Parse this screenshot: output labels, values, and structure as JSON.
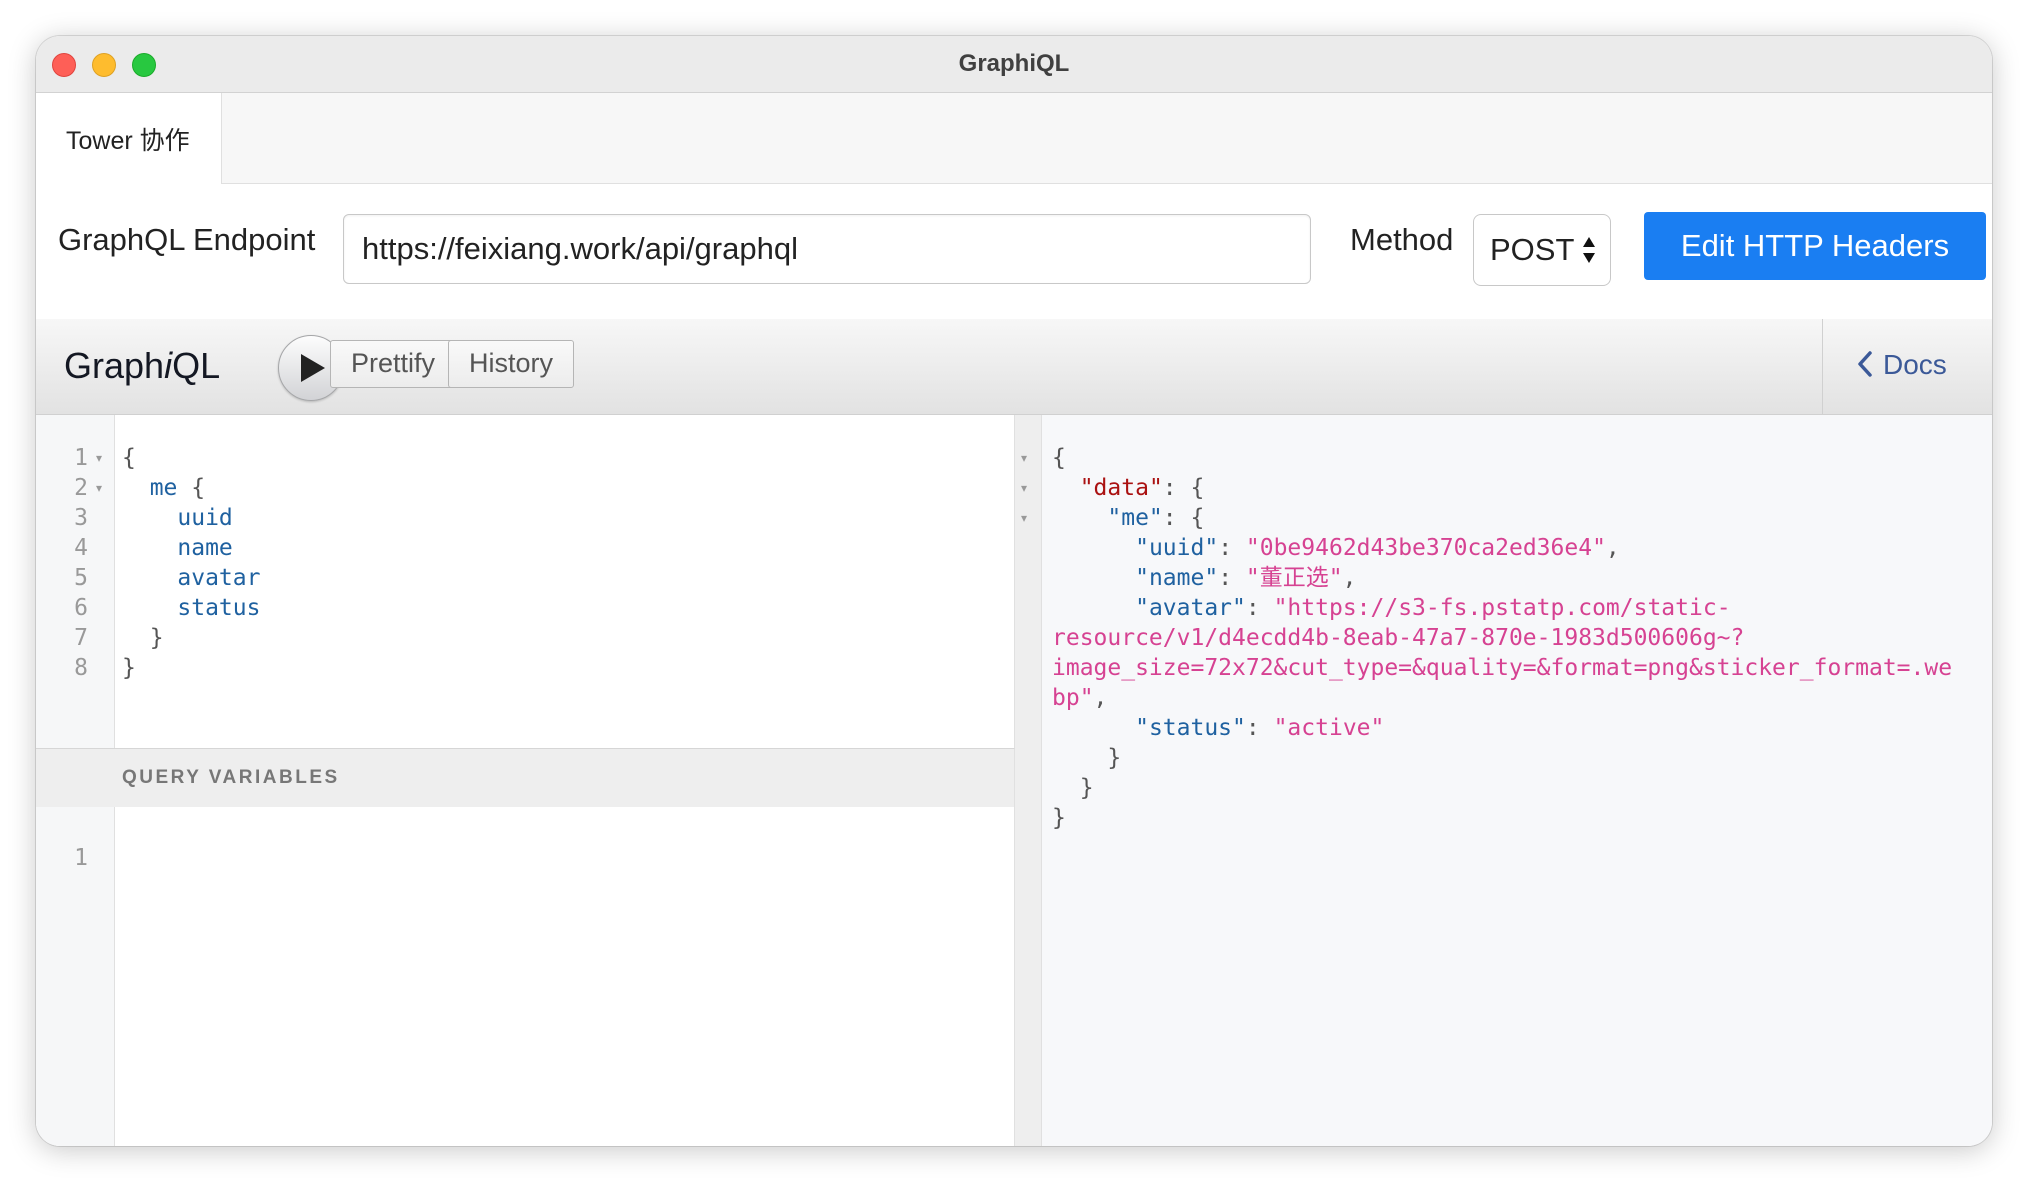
{
  "window": {
    "title": "GraphiQL"
  },
  "tabs": [
    {
      "label": "Tower 协作"
    }
  ],
  "endpoint": {
    "label": "GraphQL Endpoint",
    "url": "https://feixiang.work/api/graphql",
    "method_label": "Method",
    "method_value": "POST",
    "headers_button": "Edit HTTP Headers"
  },
  "toolbar": {
    "title_prefix": "Graph",
    "title_italic": "i",
    "title_suffix": "QL",
    "prettify_label": "Prettify",
    "history_label": "History",
    "docs_label": "Docs",
    "execute_icon": "play-icon",
    "docs_icon": "chevron-left-icon"
  },
  "query_editor": {
    "line_numbers": [
      "1",
      "2",
      "3",
      "4",
      "5",
      "6",
      "7",
      "8"
    ],
    "lines": [
      {
        "parts": [
          {
            "text": "{",
            "kind": "punct"
          }
        ]
      },
      {
        "parts": [
          {
            "text": "  ",
            "kind": "punct"
          },
          {
            "text": "me",
            "kind": "field"
          },
          {
            "text": " {",
            "kind": "punct"
          }
        ]
      },
      {
        "parts": [
          {
            "text": "    ",
            "kind": "punct"
          },
          {
            "text": "uuid",
            "kind": "field"
          }
        ]
      },
      {
        "parts": [
          {
            "text": "    ",
            "kind": "punct"
          },
          {
            "text": "name",
            "kind": "field"
          }
        ]
      },
      {
        "parts": [
          {
            "text": "    ",
            "kind": "punct"
          },
          {
            "text": "avatar",
            "kind": "field"
          }
        ]
      },
      {
        "parts": [
          {
            "text": "    ",
            "kind": "punct"
          },
          {
            "text": "status",
            "kind": "field"
          }
        ]
      },
      {
        "parts": [
          {
            "text": "  }",
            "kind": "punct"
          }
        ]
      },
      {
        "parts": [
          {
            "text": "}",
            "kind": "punct"
          }
        ]
      }
    ]
  },
  "variables": {
    "title": "QUERY VARIABLES",
    "line_numbers": [
      "1"
    ]
  },
  "result": {
    "lines": [
      {
        "parts": [
          {
            "text": "{",
            "kind": "punct"
          }
        ]
      },
      {
        "parts": [
          {
            "text": "  ",
            "kind": "punct"
          },
          {
            "text": "\"data\"",
            "kind": "key"
          },
          {
            "text": ": {",
            "kind": "punct"
          }
        ]
      },
      {
        "parts": [
          {
            "text": "    ",
            "kind": "punct"
          },
          {
            "text": "\"me\"",
            "kind": "key2"
          },
          {
            "text": ": {",
            "kind": "punct"
          }
        ]
      },
      {
        "parts": [
          {
            "text": "      ",
            "kind": "punct"
          },
          {
            "text": "\"uuid\"",
            "kind": "key2"
          },
          {
            "text": ": ",
            "kind": "punct"
          },
          {
            "text": "\"0be9462d43be370ca2ed36e4\"",
            "kind": "string"
          },
          {
            "text": ",",
            "kind": "punct"
          }
        ]
      },
      {
        "parts": [
          {
            "text": "      ",
            "kind": "punct"
          },
          {
            "text": "\"name\"",
            "kind": "key2"
          },
          {
            "text": ": ",
            "kind": "punct"
          },
          {
            "text": "\"董正选\"",
            "kind": "string"
          },
          {
            "text": ",",
            "kind": "punct"
          }
        ]
      },
      {
        "parts": [
          {
            "text": "      ",
            "kind": "punct"
          },
          {
            "text": "\"avatar\"",
            "kind": "key2"
          },
          {
            "text": ": ",
            "kind": "punct"
          },
          {
            "text": "\"https://s3-fs.pstatp.com/static-",
            "kind": "string"
          }
        ]
      },
      {
        "parts": [
          {
            "text": "resource/v1/d4ecdd4b-8eab-47a7-870e-1983d500606g~?",
            "kind": "string"
          }
        ]
      },
      {
        "parts": [
          {
            "text": "image_size=72x72&cut_type=&quality=&format=png&sticker_format=.we",
            "kind": "string"
          }
        ]
      },
      {
        "parts": [
          {
            "text": "bp\"",
            "kind": "string"
          },
          {
            "text": ",",
            "kind": "punct"
          }
        ]
      },
      {
        "parts": [
          {
            "text": "      ",
            "kind": "punct"
          },
          {
            "text": "\"status\"",
            "kind": "key2"
          },
          {
            "text": ": ",
            "kind": "punct"
          },
          {
            "text": "\"active\"",
            "kind": "string"
          }
        ]
      },
      {
        "parts": [
          {
            "text": "    }",
            "kind": "punct"
          }
        ]
      },
      {
        "parts": [
          {
            "text": "  }",
            "kind": "punct"
          }
        ]
      },
      {
        "parts": [
          {
            "text": "}",
            "kind": "punct"
          }
        ]
      }
    ]
  },
  "colors": {
    "accent": "#1a7ef2",
    "field": "#1f61a0",
    "json_key": "#a11",
    "json_string": "#d64292",
    "docs_link": "#3B5998"
  }
}
